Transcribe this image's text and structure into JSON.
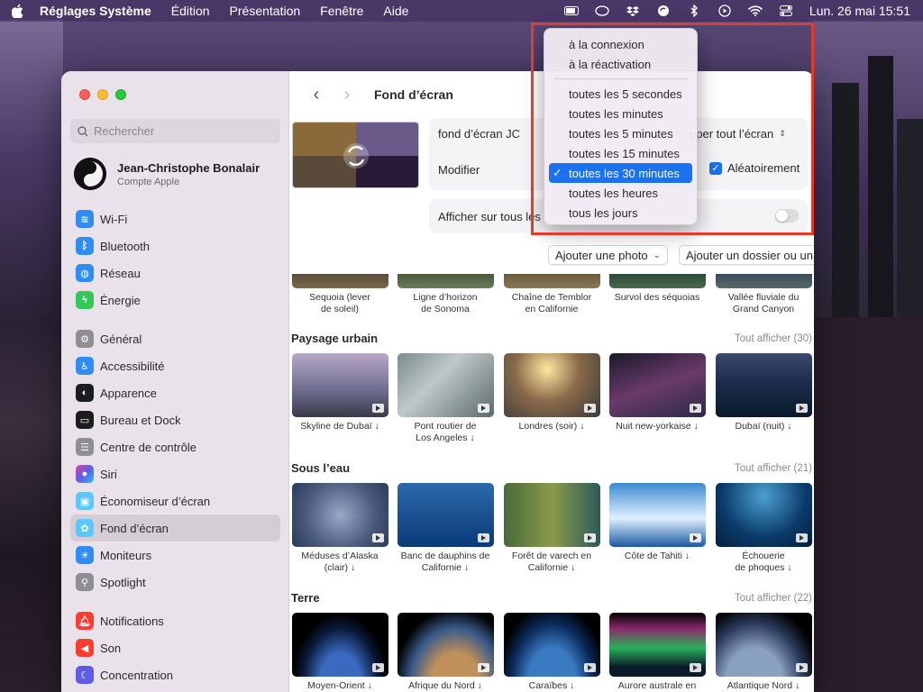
{
  "menubar": {
    "app": "Réglages Système",
    "items": [
      "Édition",
      "Présentation",
      "Fenêtre",
      "Aide"
    ],
    "clock": "Lun. 26 mai  15:51"
  },
  "sidebar": {
    "search_placeholder": "Rechercher",
    "account_name": "Jean-Christophe Bonalair",
    "account_sub": "Compte Apple",
    "group1": [
      {
        "label": "Wi-Fi",
        "color": "#2f8cf3"
      },
      {
        "label": "Bluetooth",
        "color": "#2f8cf3"
      },
      {
        "label": "Réseau",
        "color": "#2f8cf3"
      },
      {
        "label": "Énergie",
        "color": "#35c759"
      }
    ],
    "group2": [
      {
        "label": "Général",
        "color": "#8e8e93"
      },
      {
        "label": "Accessibilité",
        "color": "#2f8cf3"
      },
      {
        "label": "Apparence",
        "color": "#1c1c1e"
      },
      {
        "label": "Bureau et Dock",
        "color": "#1c1c1e"
      },
      {
        "label": "Centre de contrôle",
        "color": "#8e8e93"
      },
      {
        "label": "Siri",
        "color": "#7a4ae0"
      },
      {
        "label": "Économiseur d’écran",
        "color": "#5ac8fa"
      },
      {
        "label": "Fond d’écran",
        "color": "#5ac8fa"
      },
      {
        "label": "Moniteurs",
        "color": "#2f8cf3"
      },
      {
        "label": "Spotlight",
        "color": "#8e8e93"
      }
    ],
    "group3": [
      {
        "label": "Notifications",
        "color": "#ff3b30"
      },
      {
        "label": "Son",
        "color": "#ff3b30"
      },
      {
        "label": "Concentration",
        "color": "#5e5ce6"
      }
    ]
  },
  "content": {
    "title": "Fond d’écran",
    "wallpaper_name": "fond d’écran JC",
    "fit_label": "uper tout l’écran",
    "modify_label": "Modifier",
    "random_label": "Aléatoirement",
    "show_all_spaces": "Afficher sur tous les",
    "add_photo": "Ajouter une photo",
    "add_folder": "Ajouter un dossier ou un album"
  },
  "gallery": {
    "top_row": [
      "Sequoia (lever\nde soleil)",
      "Ligne d’horizon\nde Sonoma",
      "Chaîne de Temblor\nen Californie",
      "Survol des séquoias",
      "Vallée fluviale du\nGrand Canyon"
    ],
    "sections": [
      {
        "title": "Paysage urbain",
        "all": "Tout afficher (30)",
        "items": [
          "Skyline de Dubaï ↓",
          "Pont routier de\nLos Angeles ↓",
          "Londres (soir) ↓",
          "Nuit new-yorkaise ↓",
          "Dubaï (nuit) ↓"
        ]
      },
      {
        "title": "Sous l’eau",
        "all": "Tout afficher (21)",
        "items": [
          "Méduses d’Alaska\n(clair) ↓",
          "Banc de dauphins de\nCalifornie ↓",
          "Forêt de varech en\nCalifornie ↓",
          "Côte de Tahiti ↓",
          "Échouerie\nde phoques ↓"
        ]
      },
      {
        "title": "Terre",
        "all": "Tout afficher (22)",
        "items": [
          "Moyen-Orient ↓",
          "Afrique du Nord ↓",
          "Caraïbes ↓",
          "Aurore australe en",
          "Atlantique Nord ↓"
        ]
      }
    ]
  },
  "menu": {
    "group1": [
      "à la connexion",
      "à la réactivation"
    ],
    "group2": [
      "toutes les 5 secondes",
      "toutes les minutes",
      "toutes les 5 minutes",
      "toutes les 15 minutes",
      "toutes les 30 minutes",
      "toutes les heures",
      "tous les jours"
    ],
    "selected": "toutes les 30 minutes"
  }
}
